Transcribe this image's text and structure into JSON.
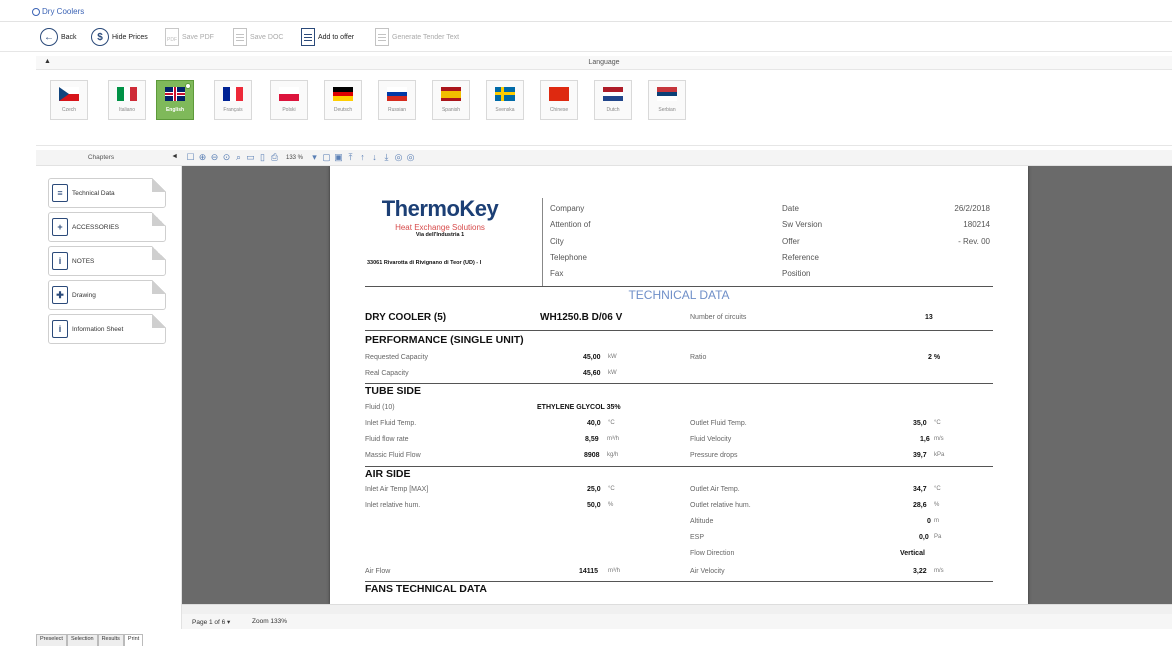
{
  "window": {
    "title": "Dry Coolers"
  },
  "toolbar": {
    "back": "Back",
    "hide_prices": "Hide Prices",
    "save_pdf": "Save PDF",
    "save_doc": "Save DOC",
    "add_to_offer": "Add to offer",
    "generate_tender": "Generate Tender Text",
    "pdf_icon_text": "PDF"
  },
  "language_panel": {
    "label": "Language",
    "collapse_glyph": "▲",
    "languages": [
      {
        "name": "Czech",
        "selected": false
      },
      {
        "name": "Italiano",
        "selected": false
      },
      {
        "name": "English",
        "selected": true
      },
      {
        "name": "Français",
        "selected": false
      },
      {
        "name": "Polski",
        "selected": false
      },
      {
        "name": "Deutsch",
        "selected": false
      },
      {
        "name": "Russian",
        "selected": false
      },
      {
        "name": "Spanish",
        "selected": false
      },
      {
        "name": "Svenska",
        "selected": false
      },
      {
        "name": "Chinese",
        "selected": false
      },
      {
        "name": "Dutch",
        "selected": false
      },
      {
        "name": "Serbian",
        "selected": false
      }
    ]
  },
  "chapters": {
    "label": "Chapters",
    "arrow": "◄",
    "items": [
      "Technical Data",
      "ACCESSORIES",
      "NOTES",
      "Drawing",
      "Information Sheet"
    ]
  },
  "viewer": {
    "zoom": "133 %"
  },
  "document": {
    "brand": "ThermoKey",
    "tagline": "Heat Exchange Solutions",
    "address_line1": "Via dell'Industria 1",
    "address_line2": "33061 Rivarotta di Rivignano di Teor (UD) - I",
    "header_labels": [
      "Company",
      "Attention of",
      "City",
      "Telephone",
      "Fax"
    ],
    "meta_labels": [
      "Date",
      "Sw Version",
      "Offer",
      "Reference",
      "Position"
    ],
    "meta_values": [
      "26/2/2018",
      "180214",
      "- Rev. 00",
      "",
      ""
    ],
    "tech_title": "TECHNICAL DATA",
    "dry_cooler_label": "DRY COOLER (5)",
    "model": "WH1250.B D/06 V",
    "circuits_label": "Number of circuits",
    "circuits_value": "13",
    "performance": {
      "title": "PERFORMANCE (SINGLE UNIT)",
      "req_label": "Requested Capacity",
      "req_value": "45,00",
      "req_unit": "kW",
      "ratio_label": "Ratio",
      "ratio_value": "2 %",
      "real_label": "Real Capacity",
      "real_value": "45,60",
      "real_unit": "kW"
    },
    "tube_side": {
      "title": "TUBE SIDE",
      "fluid_label": "Fluid (10)",
      "fluid_value": "ETHYLENE GLYCOL 35%",
      "rows": [
        {
          "l1": "Inlet Fluid Temp.",
          "v1": "40,0",
          "u1": "°C",
          "l2": "Outlet Fluid Temp.",
          "v2": "35,0",
          "u2": "°C"
        },
        {
          "l1": "Fluid flow rate",
          "v1": "8,59",
          "u1": "m³/h",
          "l2": "Fluid Velocity",
          "v2": "1,6",
          "u2": "m/s"
        },
        {
          "l1": "Massic Fluid Flow",
          "v1": "8908",
          "u1": "kg/h",
          "l2": "Pressure drops",
          "v2": "39,7",
          "u2": "kPa"
        }
      ]
    },
    "air_side": {
      "title": "AIR SIDE",
      "rows": [
        {
          "l1": "Inlet Air Temp [MAX]",
          "v1": "25,0",
          "u1": "°C",
          "l2": "Outlet Air Temp.",
          "v2": "34,7",
          "u2": "°C"
        },
        {
          "l1": "Inlet relative hum.",
          "v1": "50,0",
          "u1": "%",
          "l2": "Outlet relative hum.",
          "v2": "28,6",
          "u2": "%"
        },
        {
          "l1": "",
          "v1": "",
          "u1": "",
          "l2": "Altitude",
          "v2": "0",
          "u2": "m"
        },
        {
          "l1": "",
          "v1": "",
          "u1": "",
          "l2": "ESP",
          "v2": "0,0",
          "u2": "Pa"
        },
        {
          "l1": "",
          "v1": "",
          "u1": "",
          "l2": "Flow Direction",
          "v2": "Vertical",
          "u2": ""
        },
        {
          "l1": "Air Flow",
          "v1": "14115",
          "u1": "m³/h",
          "l2": "Air Velocity",
          "v2": "3,22",
          "u2": "m/s"
        }
      ]
    },
    "fans_title": "FANS TECHNICAL DATA"
  },
  "status": {
    "page": "Page 1 of 6 ▾",
    "zoom": "Zoom 133%"
  },
  "bottom_tabs": [
    "Preselect",
    "Selection",
    "Results",
    "Print"
  ]
}
